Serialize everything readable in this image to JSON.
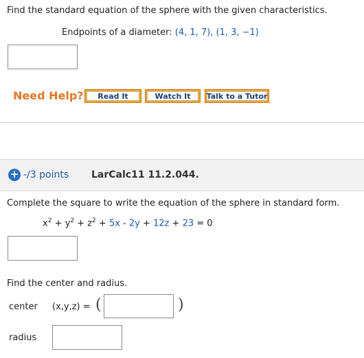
{
  "question1": {
    "prompt": "Find the standard equation of the sphere with the given characteristics.",
    "condition_label": "Endpoints of a diameter: ",
    "condition_value": "(4, 1, 7), (1, 3, −1)",
    "answer": ""
  },
  "help": {
    "label": "Need Help?",
    "read_it": "Read It",
    "watch_it": "Watch It",
    "talk_to_tutor": "Talk to a Tutor"
  },
  "question2": {
    "points": "-/3 points",
    "source": "LarCalc11 11.2.044.",
    "prompt": "Complete the square to write the equation of the sphere in standard form.",
    "equation": {
      "x_term": "x",
      "plus1": " + ",
      "y_term": "y",
      "plus2": " + ",
      "z_term": "z",
      "exp": "2",
      "rest_a": " + ",
      "c1": "5x",
      "op2": " - ",
      "c2": "2y",
      "op3": " + ",
      "c3": "12z",
      "op4": " + ",
      "c4": "23",
      "eq": " = ",
      "rhs": "0"
    },
    "answer": "",
    "sub_prompt": "Find the center and radius.",
    "center_label": "center",
    "center_vars": "(x,y,z)",
    "center_eq": "=",
    "open_paren": "(",
    "close_paren": ")",
    "radius_label": "radius",
    "center_value": "",
    "radius_value": ""
  }
}
